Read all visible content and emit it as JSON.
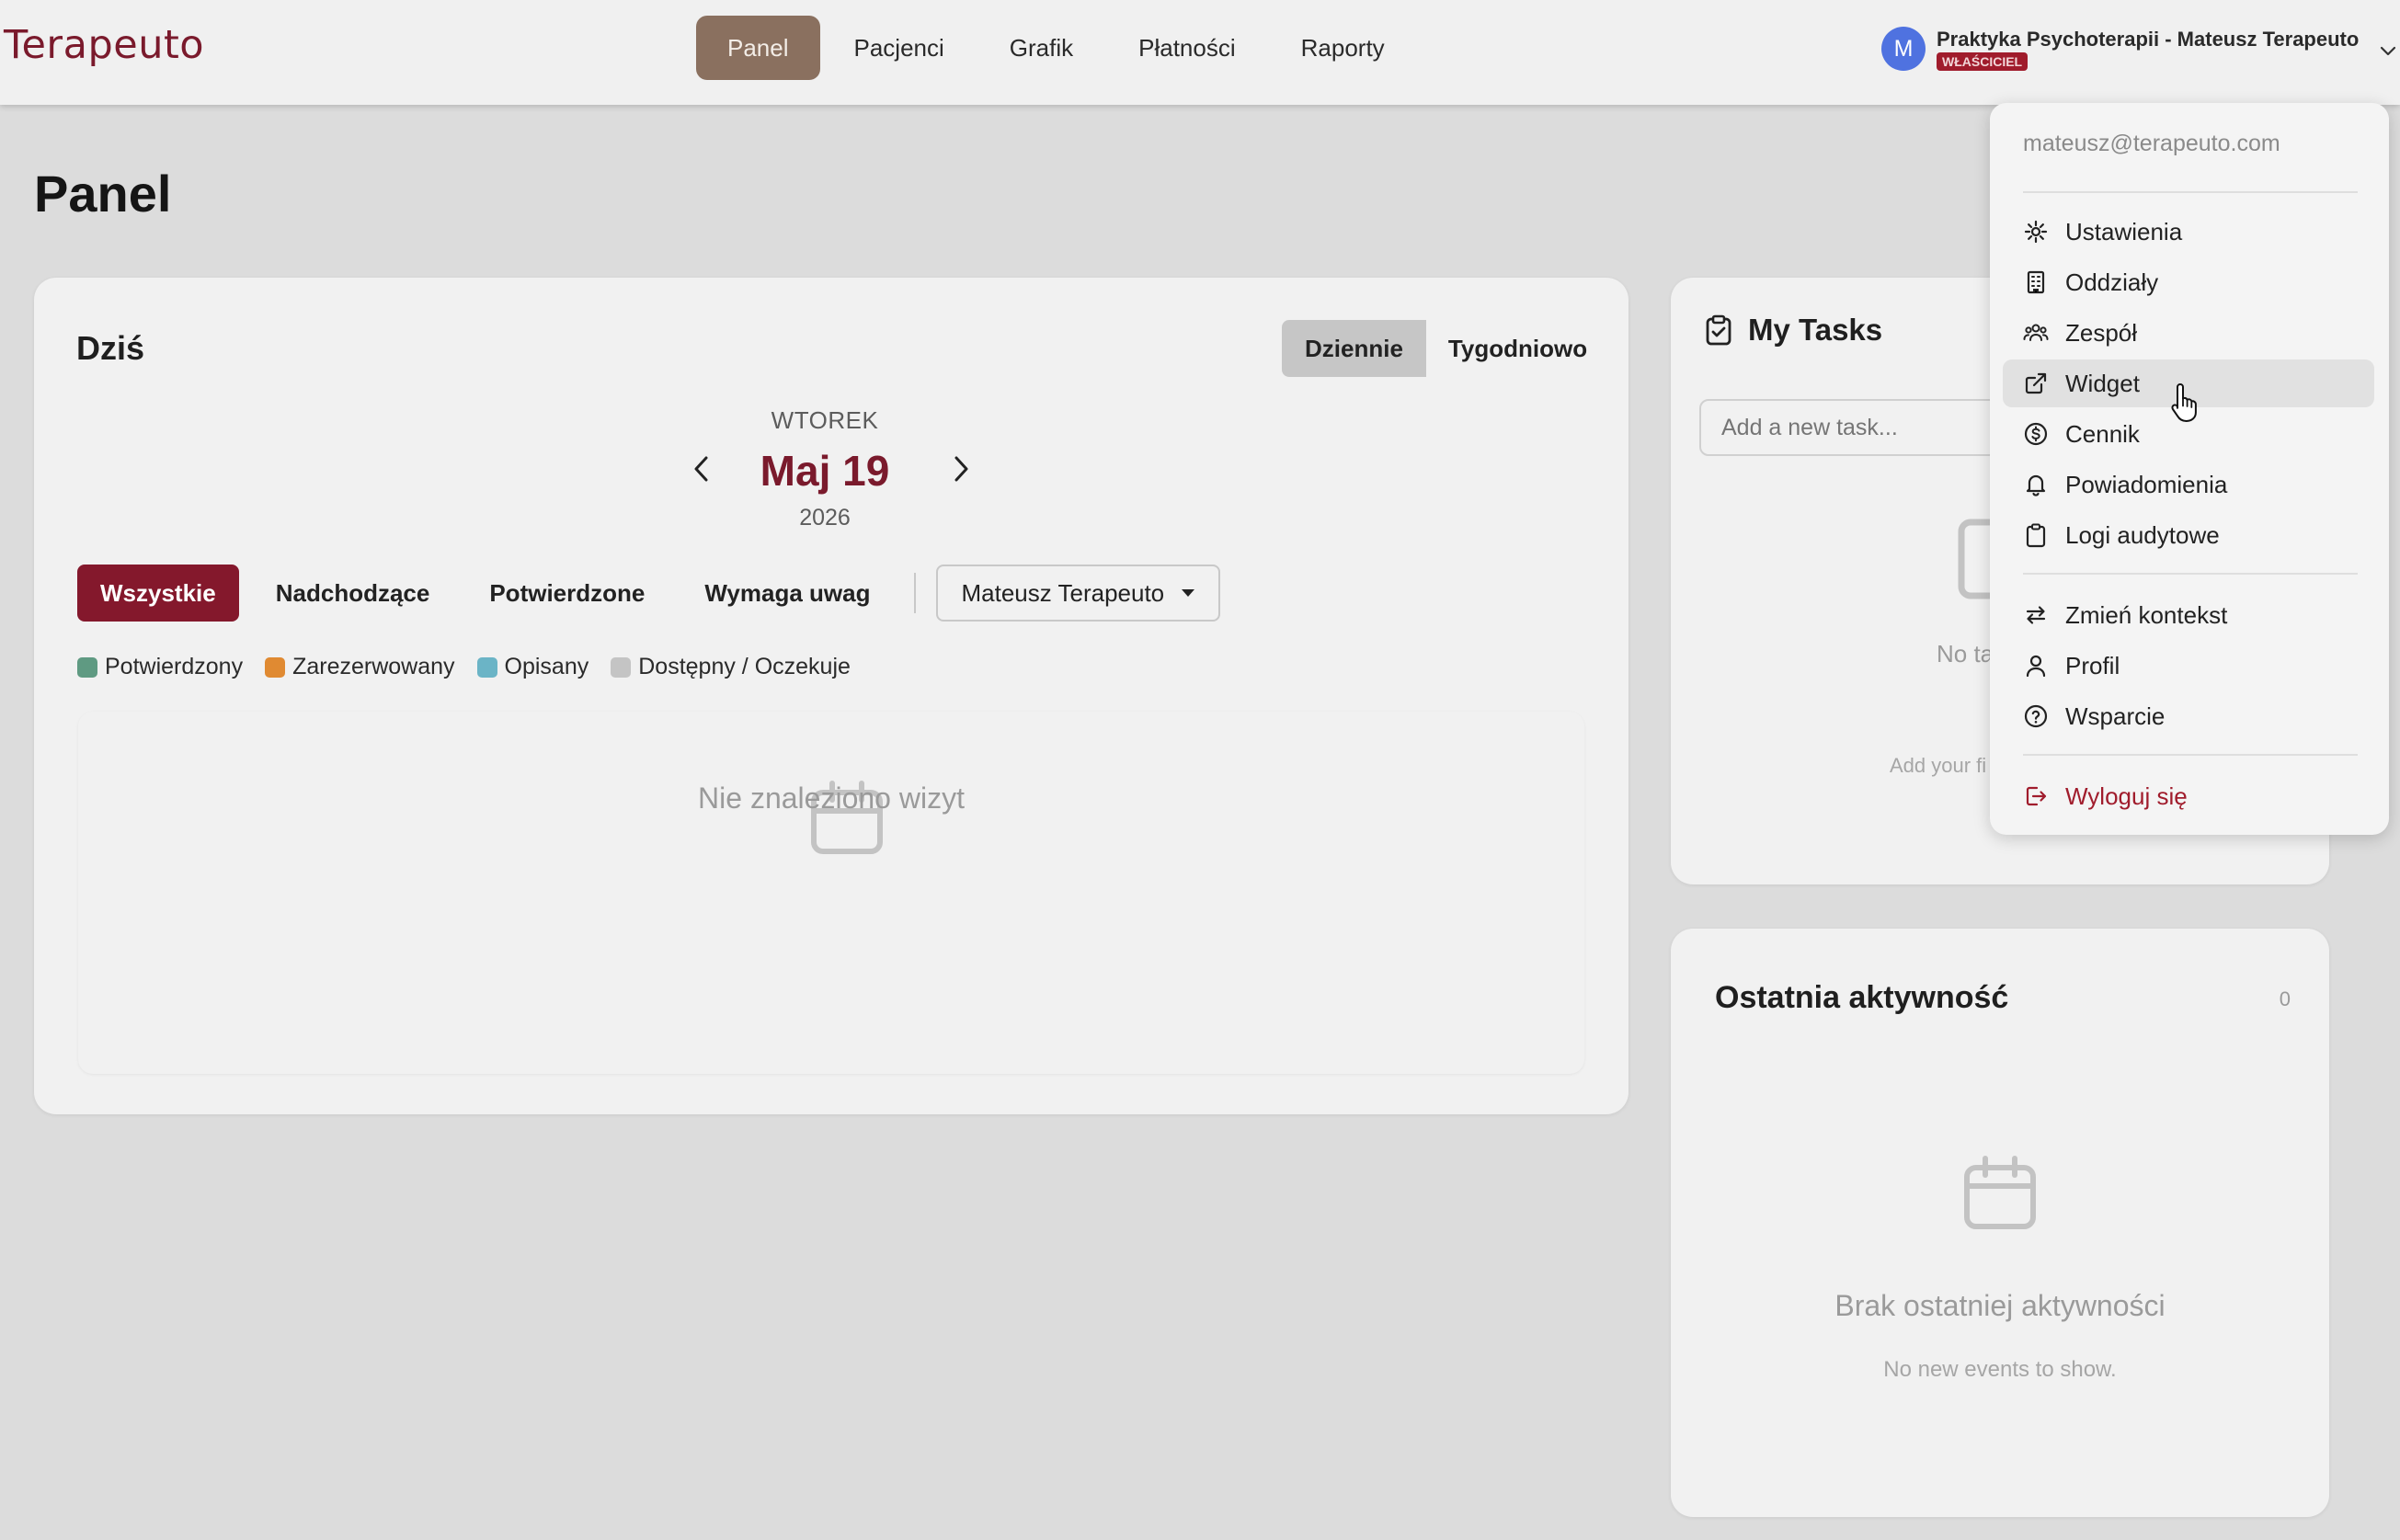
{
  "header": {
    "logo": "Terapeuto",
    "nav": [
      {
        "label": "Panel",
        "active": true
      },
      {
        "label": "Pacjenci"
      },
      {
        "label": "Grafik"
      },
      {
        "label": "Płatności"
      },
      {
        "label": "Raporty"
      }
    ],
    "account": {
      "initial": "M",
      "name": "Praktyka Psychoterapii - Mateusz Terapeuto",
      "role": "WŁAŚCICIEL"
    }
  },
  "page_title": "Panel",
  "today_card": {
    "title": "Dziś",
    "view_toggle": {
      "daily": "Dziennie",
      "weekly": "Tygodniowo",
      "selected": "Dziennie"
    },
    "date": {
      "weekday": "WTOREK",
      "day": "Maj 19",
      "year": "2026"
    },
    "filters": [
      "Wszystkie",
      "Nadchodzące",
      "Potwierdzone",
      "Wymaga uwag"
    ],
    "active_filter": "Wszystkie",
    "therapist_select": "Mateusz Terapeuto",
    "legend": [
      {
        "label": "Potwierdzony",
        "color": "#5f9a82"
      },
      {
        "label": "Zarezerwowany",
        "color": "#e08a32"
      },
      {
        "label": "Opisany",
        "color": "#6bb4c6"
      },
      {
        "label": "Dostępny / Oczekuje",
        "color": "#c4c4c4"
      }
    ],
    "empty_text": "Nie znaleziono wizyt"
  },
  "tasks_card": {
    "title": "My Tasks",
    "input_placeholder": "Add a new task...",
    "empty_partial": "No ta",
    "hint_partial": "Add your fi"
  },
  "activity_card": {
    "title": "Ostatnia aktywność",
    "count": "0",
    "empty_title": "Brak ostatniej aktywności",
    "empty_sub": "No new events to show."
  },
  "account_menu": {
    "email": "mateusz@terapeuto.com",
    "items": [
      {
        "label": "Ustawienia",
        "icon": "gear-icon"
      },
      {
        "label": "Oddziały",
        "icon": "building-icon"
      },
      {
        "label": "Zespół",
        "icon": "users-icon"
      },
      {
        "label": "Widget",
        "icon": "external-link-icon",
        "hovered": true
      },
      {
        "label": "Cennik",
        "icon": "dollar-circle-icon"
      },
      {
        "label": "Powiadomienia",
        "icon": "bell-icon"
      },
      {
        "label": "Logi audytowe",
        "icon": "clipboard-icon"
      },
      {
        "label": "Zmień kontekst",
        "icon": "switch-arrows-icon"
      },
      {
        "label": "Profil",
        "icon": "user-icon"
      },
      {
        "label": "Wsparcie",
        "icon": "help-circle-icon"
      },
      {
        "label": "Wyloguj się",
        "icon": "logout-icon"
      }
    ]
  },
  "colors": {
    "brand": "#7a1a2c",
    "nav_active": "#8a705f",
    "filter_active": "#84182c",
    "avatar": "#4f72e0"
  }
}
